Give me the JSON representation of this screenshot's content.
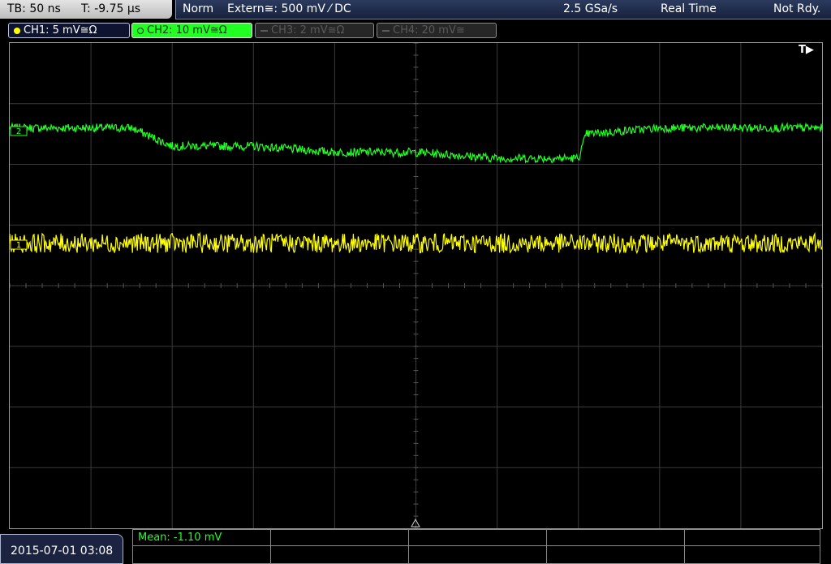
{
  "timebase": {
    "tb_label": "TB: 50 ns",
    "trigger_time": "T: -9.75 µs"
  },
  "status": {
    "mode": "Norm",
    "trigger_source": "Extern≅: 500 mV ⁄ DC",
    "sample_rate": "2.5 GSa/s",
    "acq_mode": "Real Time",
    "state": "Not Rdy."
  },
  "channels": [
    {
      "label": "CH1: 5 mV≅Ω",
      "color": "#ffff00"
    },
    {
      "label": "CH2: 10 mV≅Ω",
      "color": "#22ff22"
    },
    {
      "label": "CH3: 2 mV≅Ω",
      "color": "#5a5a5a"
    },
    {
      "label": "CH4: 20 mV≅",
      "color": "#5a5a5a"
    }
  ],
  "trigger_marker": "T▶",
  "markers": {
    "ch2": "2",
    "ch1": "1"
  },
  "timestamp": "2015-07-01 03:08",
  "measurement": {
    "mean_label": "Mean: -1.10 mV"
  },
  "chart_data": {
    "type": "line",
    "title": "",
    "xlabel": "",
    "ylabel": "",
    "grid": true,
    "grid_divisions": {
      "horizontal": 10,
      "vertical": 8
    },
    "series": [
      {
        "channel": "CH2",
        "color": "#22ff22",
        "x_div": [
          0,
          1.5,
          2,
          3,
          4,
          5,
          6,
          7,
          7.1,
          8,
          9,
          10
        ],
        "y_div": [
          2.6,
          2.6,
          2.3,
          2.3,
          2.2,
          2.2,
          2.1,
          2.1,
          2.5,
          2.6,
          2.6,
          2.6
        ]
      },
      {
        "channel": "CH1",
        "color": "#ffff00",
        "x_div": [
          0,
          10
        ],
        "y_div": [
          0.7,
          0.7
        ]
      }
    ]
  }
}
